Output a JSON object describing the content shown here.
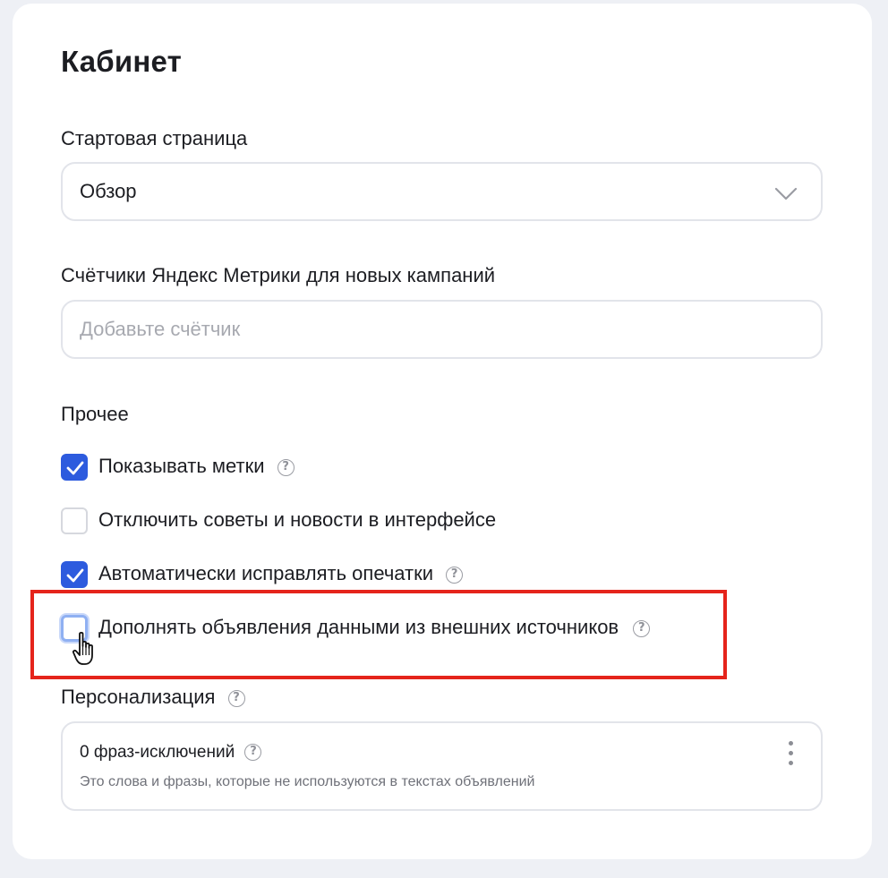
{
  "page": {
    "title": "Кабинет"
  },
  "start_page": {
    "label": "Стартовая страница",
    "value": "Обзор",
    "icon": "chevron-down-icon"
  },
  "metrika": {
    "label": "Счётчики Яндекс Метрики для новых кампаний",
    "placeholder": "Добавьте счётчик"
  },
  "other": {
    "label": "Прочее",
    "options": [
      {
        "label": "Показывать метки",
        "checked": true,
        "help": true
      },
      {
        "label": "Отключить советы и новости в интерфейсе",
        "checked": false,
        "help": false
      },
      {
        "label": "Автоматически исправлять опечатки",
        "checked": true,
        "help": true
      },
      {
        "label": "Дополнять объявления данными из внешних источников",
        "checked": false,
        "help": true,
        "focused": true
      }
    ]
  },
  "personalization": {
    "label": "Персонализация",
    "title": "0 фраз-исключений",
    "subtitle": "Это слова и фразы, которые не используются в текстах объявлений"
  },
  "help_glyph": "?",
  "colors": {
    "accent": "#2d5bde",
    "highlight": "#e5241b",
    "background": "#eef0f5"
  }
}
